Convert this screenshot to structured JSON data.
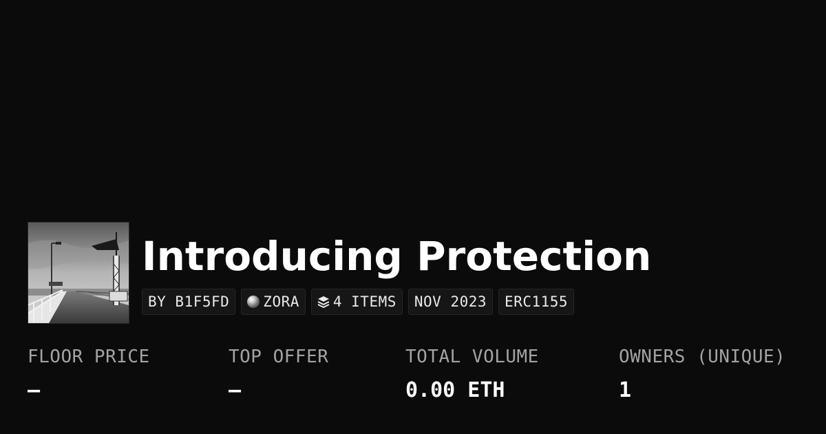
{
  "collection": {
    "title": "Introducing Protection",
    "thumbnail_icon": "pier-photo"
  },
  "tags": {
    "creator": "BY B1F5FD",
    "chain": "ZORA",
    "chain_icon": "zora-orb-icon",
    "items": "4 ITEMS",
    "items_icon": "layers-icon",
    "date": "NOV 2023",
    "standard": "ERC1155"
  },
  "stats": {
    "floor_price": {
      "label": "FLOOR PRICE",
      "value": "—"
    },
    "top_offer": {
      "label": "TOP OFFER",
      "value": "—"
    },
    "total_volume": {
      "label": "TOTAL VOLUME",
      "value": "0.00 ETH"
    },
    "owners": {
      "label": "OWNERS (UNIQUE)",
      "value": "1"
    }
  },
  "colors": {
    "background": "#0b0b0b",
    "text": "#ffffff",
    "muted": "#a3a3a3",
    "tag_bg": "#161616"
  }
}
